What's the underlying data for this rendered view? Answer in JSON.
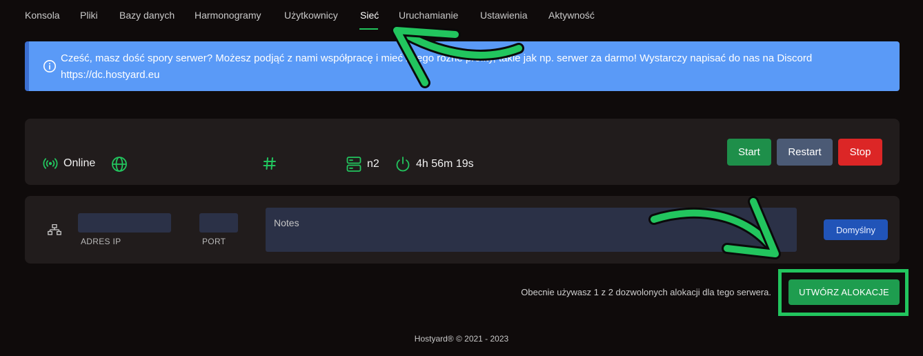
{
  "nav": {
    "tabs": [
      {
        "label": "Konsola"
      },
      {
        "label": "Pliki"
      },
      {
        "label": "Bazy danych"
      },
      {
        "label": "Harmonogramy"
      },
      {
        "label": "Użytkownicy"
      },
      {
        "label": "Sieć",
        "active": true
      },
      {
        "label": "Uruchamianie"
      },
      {
        "label": "Ustawienia"
      },
      {
        "label": "Aktywność"
      }
    ]
  },
  "alert": {
    "icon": "info-icon",
    "text": "Cześć, masz dość spory serwer? Możesz podjąć z nami współpracę i mieć z tego różne profity, takie jak np. serwer za darmo! Wystarczy napisać do nas na Discord https://dc.hostyard.eu"
  },
  "status": {
    "state": "Online",
    "node": "n2",
    "uptime": "4h 56m 19s",
    "buttons": {
      "start": "Start",
      "restart": "Restart",
      "stop": "Stop"
    }
  },
  "allocation": {
    "ip_label": "ADRES IP",
    "port_label": "PORT",
    "notes_placeholder": "Notes",
    "default_label": "Domyślny"
  },
  "usage_text": "Obecnie używasz 1 z 2 dozwolonych alokacji dla tego serwera.",
  "create_button": "UTWÓRZ ALOKACJE",
  "footer": "Hostyard® © 2021 - 2023",
  "colors": {
    "background": "#0f0b0b",
    "card": "#211c1c",
    "accent_green": "#22c55e",
    "alert_blue": "#5a9af7",
    "stop_red": "#dc2626"
  }
}
